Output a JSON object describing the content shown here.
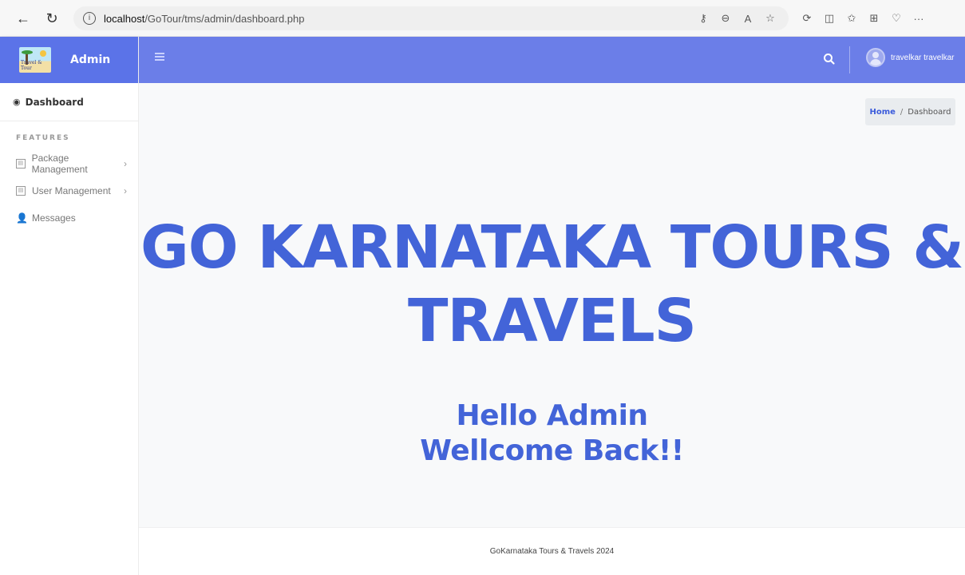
{
  "browser": {
    "url_host": "localhost",
    "url_path": "/GoTour/tms/admin/dashboard.php",
    "back_icon": "arrow-left-icon",
    "refresh_icon": "refresh-icon",
    "more_label": "···"
  },
  "sidebar": {
    "brand_title": "Admin",
    "logo_caption": "Travel & Tour",
    "dashboard_label": "Dashboard",
    "section_label": "FEATURES",
    "items": [
      {
        "label": "Package Management",
        "has_submenu": true
      },
      {
        "label": "User Management",
        "has_submenu": true
      },
      {
        "label": "Messages",
        "has_submenu": false
      }
    ]
  },
  "header": {
    "user_name": "travelkar travelkar"
  },
  "breadcrumb": {
    "home": "Home",
    "separator": "/",
    "current": "Dashboard"
  },
  "main": {
    "title_line1": "GO KARNATAKA TOURS &",
    "title_line2": "TRAVELS",
    "greeting_line1": "Hello Admin",
    "greeting_line2": "Wellcome Back!!"
  },
  "footer": {
    "text": "GoKarnataka Tours & Travels 2024"
  },
  "colors": {
    "accent": "#5b73e8",
    "header": "#6b7ee8",
    "hero_text": "#4364d8"
  }
}
